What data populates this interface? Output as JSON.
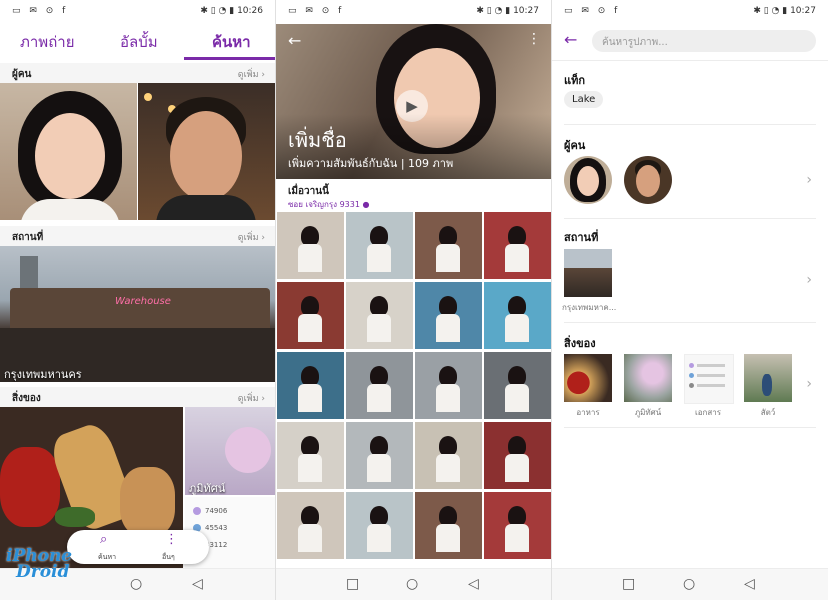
{
  "status": {
    "left_icons": "▭ ✉ ⊙ f",
    "time_1": "10:26",
    "time_2": "10:27",
    "time_3": "10:27"
  },
  "screen1": {
    "tabs": [
      "ภาพถ่าย",
      "อัลบั้ม",
      "ค้นหา"
    ],
    "people": {
      "title": "ผู้คน",
      "more": "ดูเพิ่ม"
    },
    "places": {
      "title": "สถานที่",
      "more": "ดูเพิ่ม",
      "caption": "กรุงเทพมหานคร"
    },
    "things": {
      "title": "สิ่งของ",
      "more": "ดูเพิ่ม",
      "caption": "ภูมิทัศน์"
    },
    "doc_numbers": [
      "74906",
      "45543",
      "33112"
    ],
    "fab": {
      "search_label": "ค้นหา",
      "more_label": "อื่นๆ"
    },
    "watermark": {
      "line1": "iPhone",
      "line2": "Droid"
    }
  },
  "screen2": {
    "title": "เพิ่มชื่อ",
    "subtitle": "เพิ่มความสัมพันธ์กับฉัน",
    "count": "109 ภาพ",
    "date": "เมื่อวานนี้",
    "location": "ซอย เจริญกรุง 9331"
  },
  "screen3": {
    "search_placeholder": "ค้นหารูปภาพ...",
    "tags": {
      "title": "แท็ก",
      "chip": "Lake"
    },
    "people": {
      "title": "ผู้คน"
    },
    "places": {
      "title": "สถานที่",
      "caption": "กรุงเทพมหาค..."
    },
    "things": {
      "title": "สิ่งของ",
      "captions": [
        "อาหาร",
        "ภูมิทัศน์",
        "เอกสาร",
        "สัตว์"
      ]
    }
  },
  "colors": {
    "accent": "#7a2aa8",
    "watermark": "#2a8fd8"
  }
}
